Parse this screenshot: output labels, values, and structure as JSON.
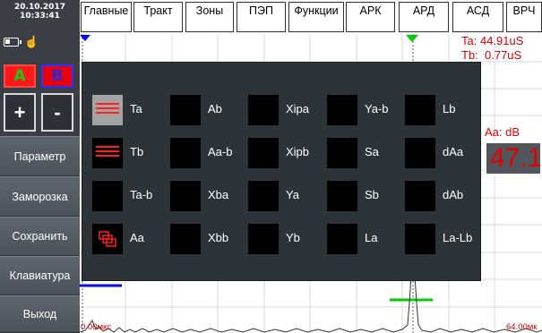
{
  "left": {
    "date": "20.10.2017",
    "time": "10:33:41",
    "a_label": "A",
    "b_label": "B",
    "plus": "+",
    "minus": "-",
    "buttons": [
      "Параметр",
      "Заморозка",
      "Сохранить",
      "Клавиатура",
      "Выход"
    ]
  },
  "tabs": [
    "Главные",
    "Тракт",
    "Зоны",
    "ПЭП",
    "Функции",
    "АРК",
    "АРД",
    "АСД",
    "ВРЧ"
  ],
  "readout": {
    "ta": "Ta: 44.91uS",
    "tb": "Tb:  0.77uS",
    "aa_title": "Aa: dB",
    "aa_value": "47.1"
  },
  "axis": {
    "start": "0.00мкс",
    "end": "64.00мк"
  },
  "params": [
    [
      "Ta",
      "Ab",
      "Xipa",
      "Ya-b",
      "Lb"
    ],
    [
      "Tb",
      "Aa-b",
      "Xipb",
      "Sa",
      "dAa"
    ],
    [
      "Ta-b",
      "Xba",
      "Ya",
      "Sb",
      "dAb"
    ],
    [
      "Aa",
      "Xbb",
      "Yb",
      "La",
      "La-Lb"
    ]
  ],
  "colors": {
    "accent": "#e00000",
    "gate_a": "#0000ff",
    "gate_b": "#00cc00",
    "panel": "#3b3f45"
  },
  "icons": {
    "battery": "battery-icon",
    "touch": "touch-hand-icon",
    "selected_lines": "selected-lines-icon",
    "selected_copy": "selected-copy-icon"
  }
}
